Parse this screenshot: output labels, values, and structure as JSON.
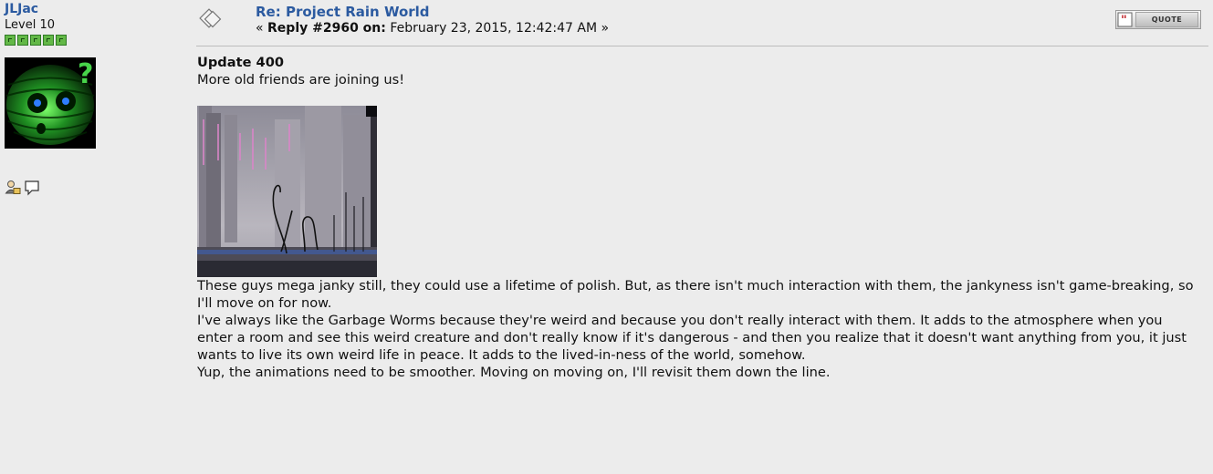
{
  "poster": {
    "name": "JLJac",
    "level": "Level 10",
    "stars": 5
  },
  "post": {
    "subject": "Re: Project Rain World",
    "reply_prefix": "« ",
    "reply_label": "Reply #2960 on:",
    "reply_date": " February 23, 2015, 12:42:47 AM »",
    "quote_label": "QUOTE"
  },
  "body": {
    "title": "Update 400",
    "intro": "More old friends are joining us!",
    "paragraph1": "These guys mega janky still, they could use a lifetime of polish. But, as there isn't much interaction with them, the jankyness isn't game-breaking, so I'll move on for now.",
    "paragraph2": "I've always like the Garbage Worms because they're weird and because you don't really interact with them. It adds to the atmosphere when you enter a room and see this weird creature and don't really know if it's dangerous - and then you realize that it doesn't want anything from you, it just wants to live its own weird life in peace. It adds to the lived-in-ness of the world, somehow.",
    "paragraph3": "Yup, the animations need to be smoother. Moving on moving on, I'll revisit them down the line."
  },
  "icons": {
    "message": "message-icon",
    "profile": "profile-icon",
    "pm": "speech-bubble-icon",
    "quote": "quote-icon"
  },
  "colors": {
    "link": "#2b5aa0",
    "star_fill": "#63b847",
    "background": "#ececec"
  }
}
